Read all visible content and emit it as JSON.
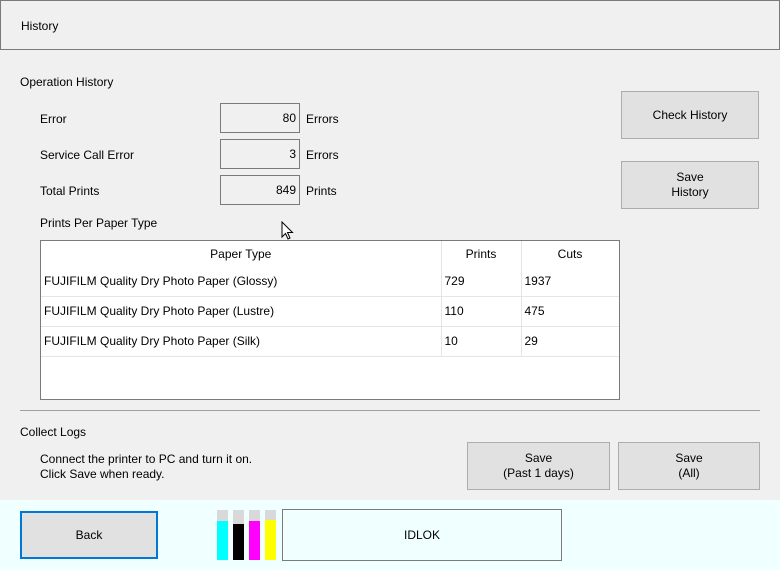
{
  "header": {
    "title": "History"
  },
  "operation_history": {
    "section_label": "Operation History",
    "error_label": "Error",
    "error_value": "80",
    "error_unit": "Errors",
    "service_call_label": "Service Call Error",
    "service_call_value": "3",
    "service_call_unit": "Errors",
    "total_prints_label": "Total Prints",
    "total_prints_value": "849",
    "total_prints_unit": "Prints",
    "ppt_label": "Prints Per Paper Type"
  },
  "buttons": {
    "check_history": "Check History",
    "save_history": "Save\nHistory",
    "save_1day": "Save\n(Past 1 days)",
    "save_all": "Save\n(All)",
    "back": "Back"
  },
  "paper_table": {
    "headers": [
      "Paper Type",
      "Prints",
      "Cuts"
    ],
    "rows": [
      [
        "FUJIFILM Quality Dry Photo Paper (Glossy)",
        "729",
        "1937"
      ],
      [
        "FUJIFILM Quality Dry Photo Paper (Lustre)",
        "110",
        "475"
      ],
      [
        "FUJIFILM Quality Dry Photo Paper (Silk)",
        "10",
        "29"
      ]
    ]
  },
  "collect_logs": {
    "label": "Collect Logs",
    "line1": "Connect the printer to PC and turn it on.",
    "line2": "Click Save when ready."
  },
  "ink_levels": [
    {
      "color": "#00ffff",
      "level": 0.78
    },
    {
      "color": "#000000",
      "level": 0.72
    },
    {
      "color": "#ff00ff",
      "level": 0.78
    },
    {
      "color": "#ffff00",
      "level": 0.8
    }
  ],
  "status": {
    "text": "IDLOK"
  }
}
